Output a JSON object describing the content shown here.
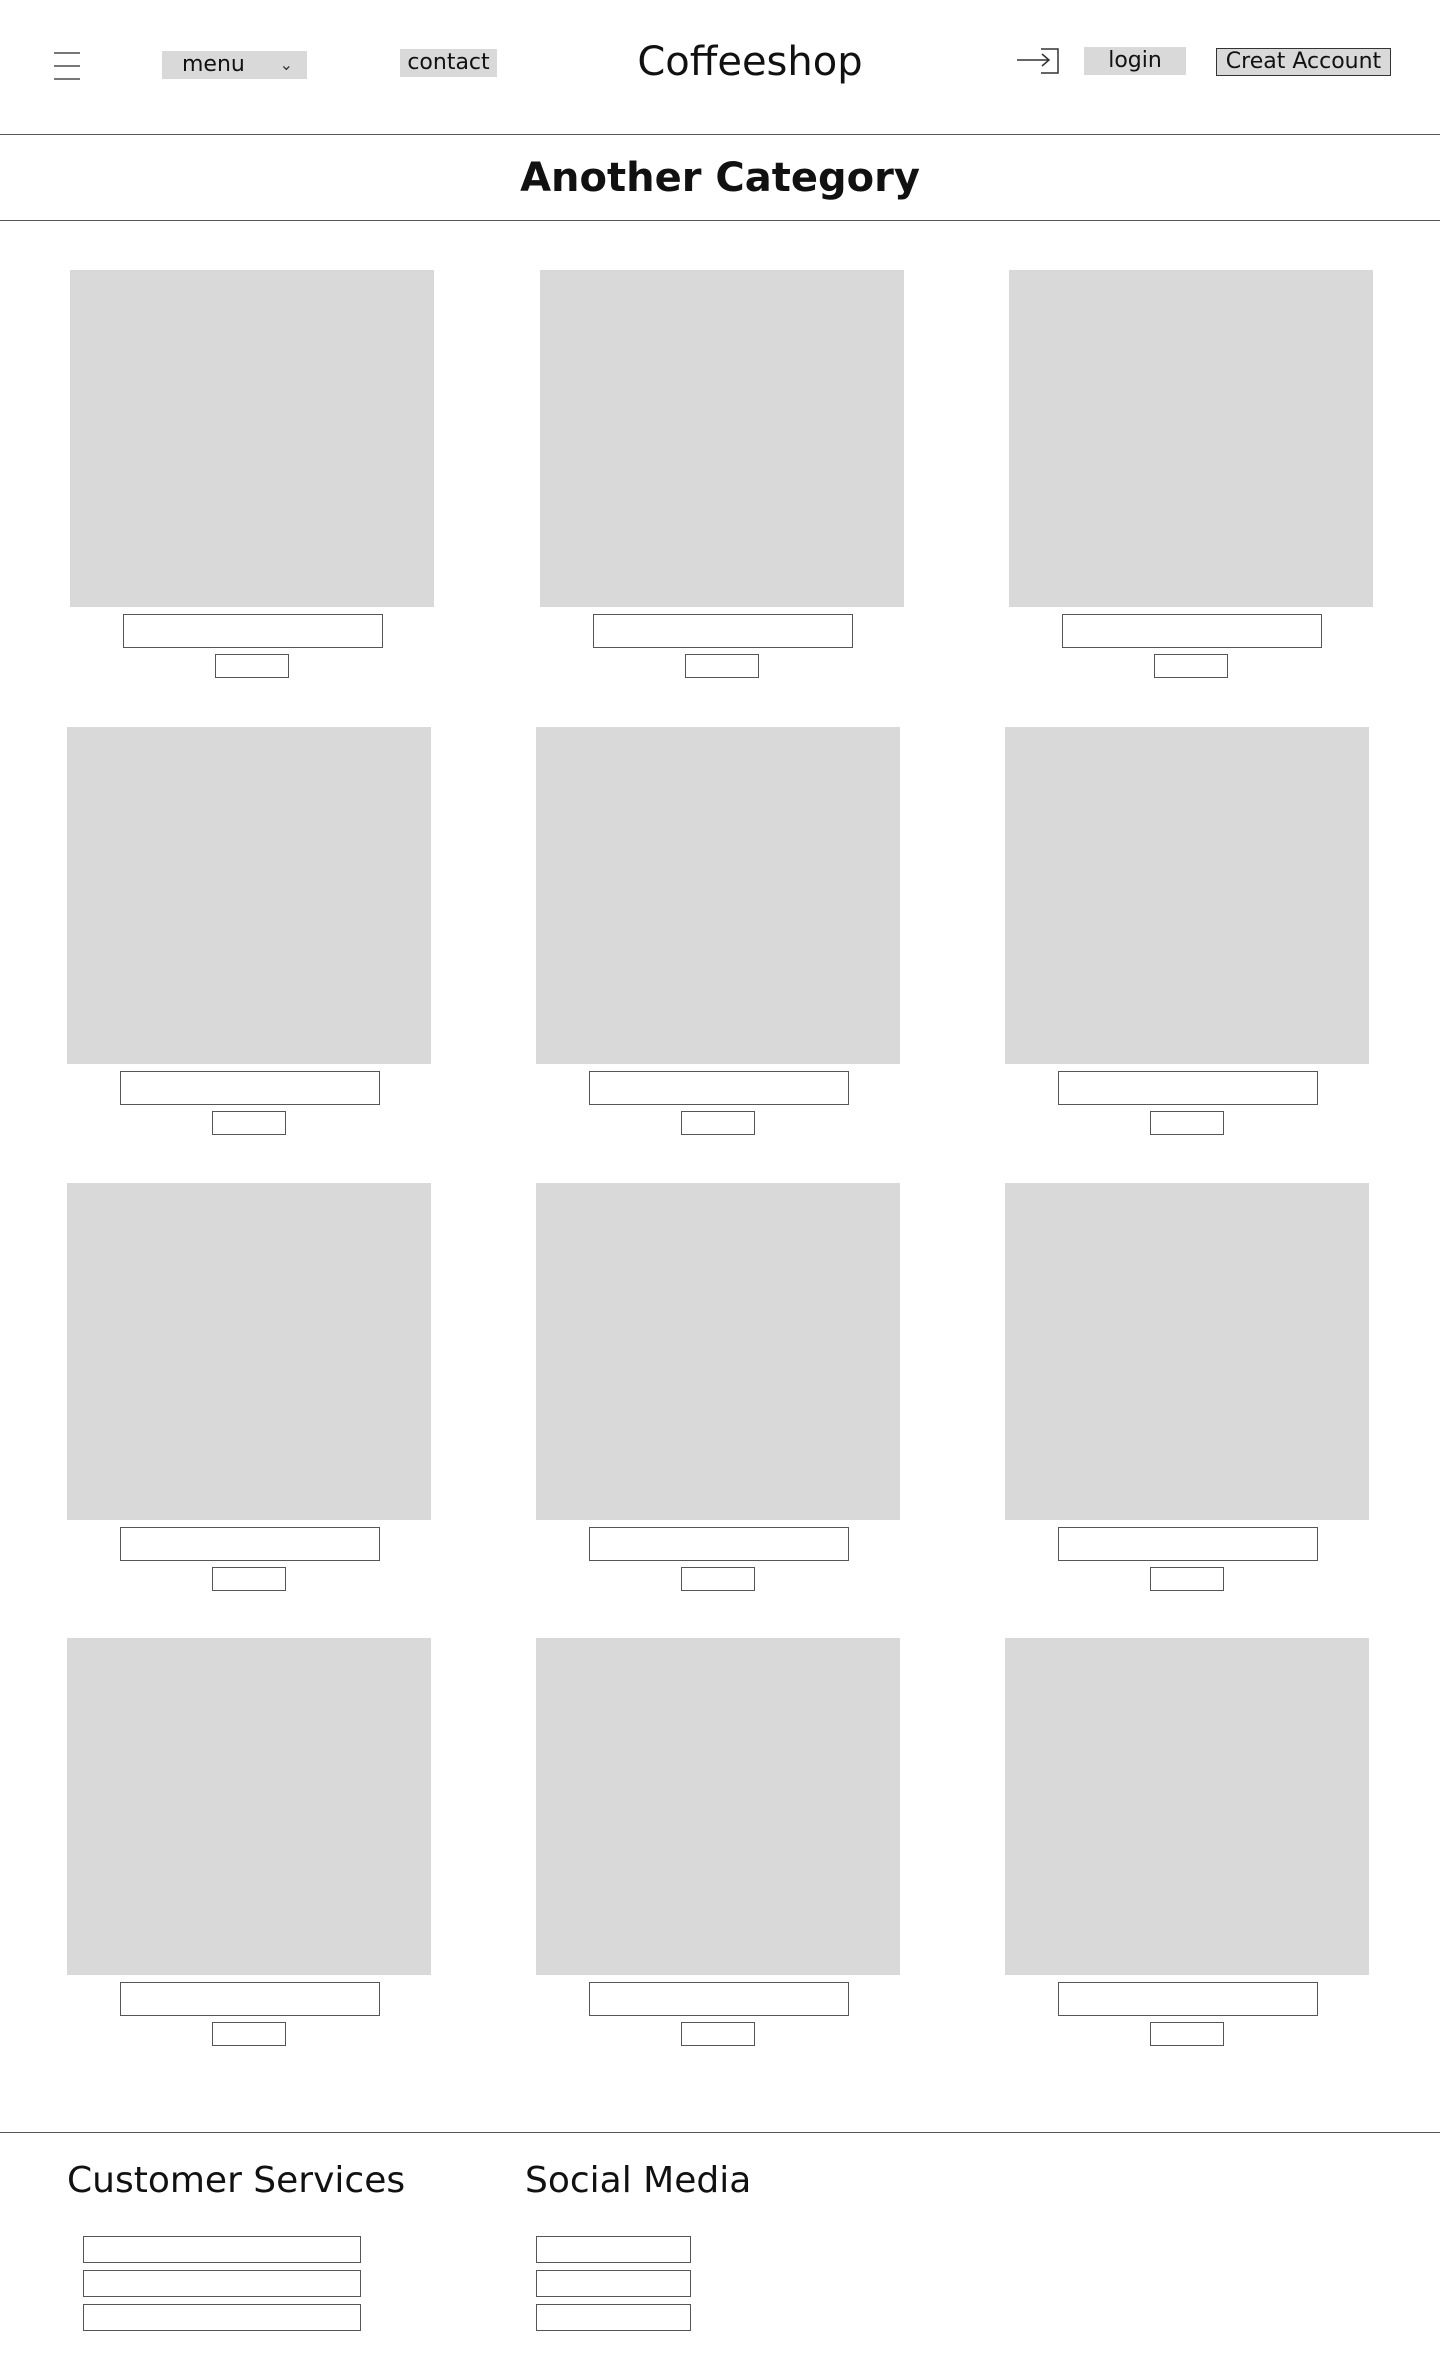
{
  "header": {
    "menu_label": "menu",
    "menu_chevron": "⌄",
    "contact_label": "contact",
    "site_title": "Coffeeshop",
    "login_label": "login",
    "create_account_label": "Creat Account",
    "icons": [
      "hamburger-menu-icon",
      "chevron-down-icon",
      "login-arrow-icon"
    ]
  },
  "category": {
    "title": "Another Category"
  },
  "footer": {
    "customer_services_heading": "Customer Services",
    "social_media_heading": "Social Media"
  },
  "colors": {
    "placeholder_gray": "#d9d9d9",
    "outline": "#555555",
    "text": "#111111"
  }
}
